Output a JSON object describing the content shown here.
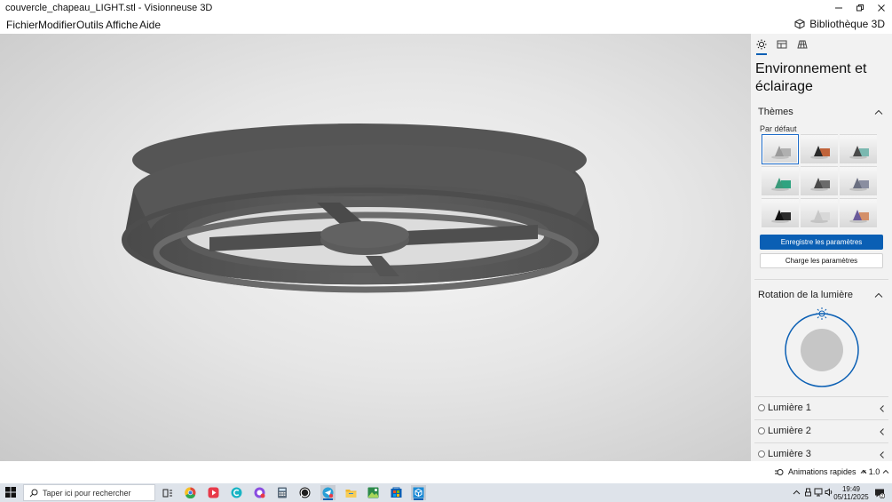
{
  "window": {
    "title": "couvercle_chapeau_LIGHT.stl - Visionneuse 3D",
    "controls": [
      "minimize-icon",
      "restore-icon",
      "close-icon"
    ]
  },
  "menu": {
    "items": [
      "Fichier",
      "Modifier",
      "Outils",
      "Affiche",
      "Aide"
    ],
    "library_label": "Bibliothèque 3D"
  },
  "panel": {
    "tabs": [
      "environment-tab",
      "stats-tab",
      "grid-tab"
    ],
    "heading": "Environnement et éclairage",
    "themes": {
      "title": "Thèmes",
      "subtitle": "Par défaut",
      "save_button": "Enregistre les paramètres",
      "load_button": "Charge les paramètres",
      "swatches": [
        {
          "name": "default",
          "colors": [
            "#9a9a9a",
            "#b0b0b0"
          ],
          "selected": true
        },
        {
          "name": "warm",
          "colors": [
            "#2a2a2a",
            "#c0633a"
          ]
        },
        {
          "name": "teal",
          "colors": [
            "#4a4a4a",
            "#7ab8b0"
          ]
        },
        {
          "name": "green",
          "colors": [
            "#3a9a7a",
            "#2fa380"
          ]
        },
        {
          "name": "dark-gray",
          "colors": [
            "#4a4a4a",
            "#6a6a6a"
          ]
        },
        {
          "name": "slate",
          "colors": [
            "#6a6f80",
            "#8a8ea0"
          ]
        },
        {
          "name": "black",
          "colors": [
            "#111111",
            "#2a2a2a"
          ]
        },
        {
          "name": "light",
          "colors": [
            "#c8c8c8",
            "#d8d8d8"
          ]
        },
        {
          "name": "sunset",
          "colors": [
            "#6a5a9a",
            "#d4906a"
          ]
        }
      ]
    },
    "rotation": {
      "title": "Rotation de la lumière"
    },
    "lights": [
      "Lumière 1",
      "Lumière 2",
      "Lumière 3"
    ]
  },
  "statusbar": {
    "animations_label": "Animations rapides",
    "speed_label": "× 1.0"
  },
  "taskbar": {
    "search_placeholder": "Taper ici pour rechercher",
    "apps": [
      "task-view-icon",
      "chrome-icon",
      "media-icon",
      "canva-icon",
      "messenger-icon",
      "calculator-icon",
      "whatsapp-icon",
      "telegram-icon",
      "file-explorer-icon",
      "photos-icon",
      "store-icon",
      "3d-viewer-icon"
    ],
    "time": "19:49",
    "date": "05/11/2025",
    "notification_count": "2"
  },
  "colors": {
    "accent": "#0a5fb4",
    "model": "#5a5a5a"
  }
}
